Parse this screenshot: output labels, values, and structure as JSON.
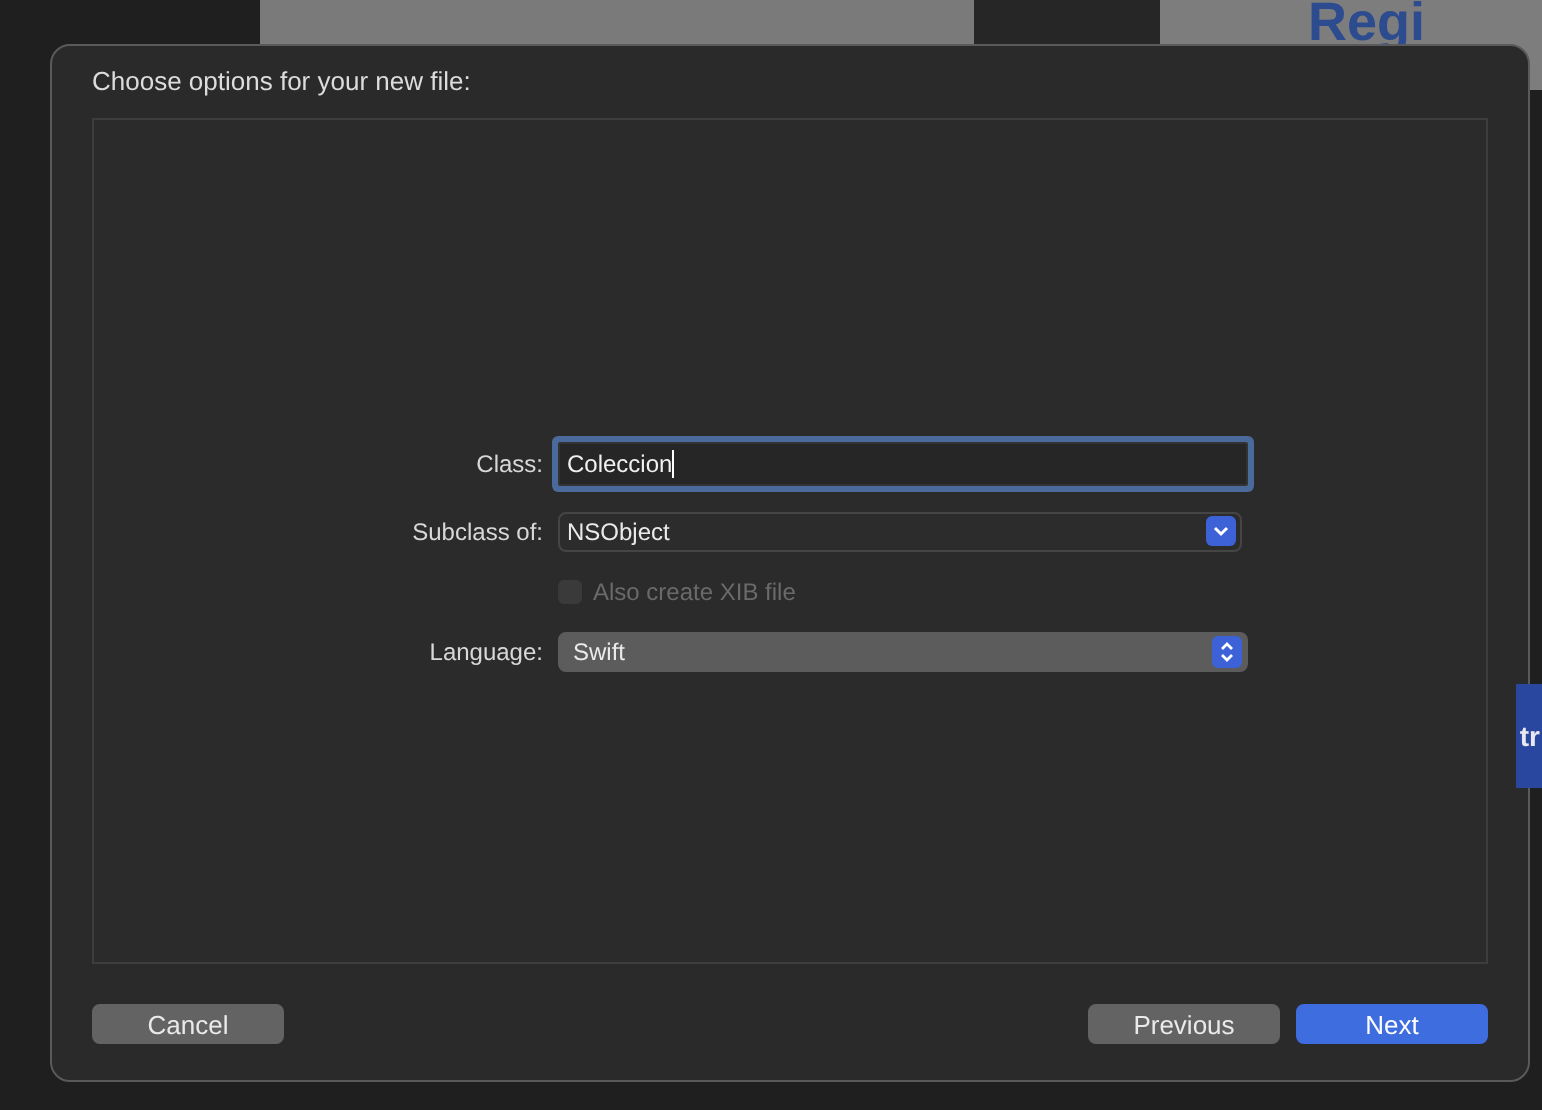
{
  "background": {
    "heading": "Regi",
    "tag": "tr"
  },
  "dialog": {
    "title": "Choose options for your new file:",
    "fields": [
      {
        "kind": "text",
        "label": "Class:",
        "value": "Coleccion",
        "focused": true
      },
      {
        "kind": "popup",
        "label": "Subclass of:",
        "value": "NSObject"
      },
      {
        "kind": "checkbox",
        "label": "Also create XIB file",
        "checked": false,
        "disabled": true
      },
      {
        "kind": "selector",
        "label": "Language:",
        "value": "Swift"
      }
    ],
    "left_buttons": [
      {
        "label": "Cancel",
        "kind": "secondary"
      }
    ],
    "right_buttons": [
      {
        "label": "Previous",
        "kind": "secondary"
      },
      {
        "label": "Next",
        "kind": "default"
      }
    ]
  }
}
